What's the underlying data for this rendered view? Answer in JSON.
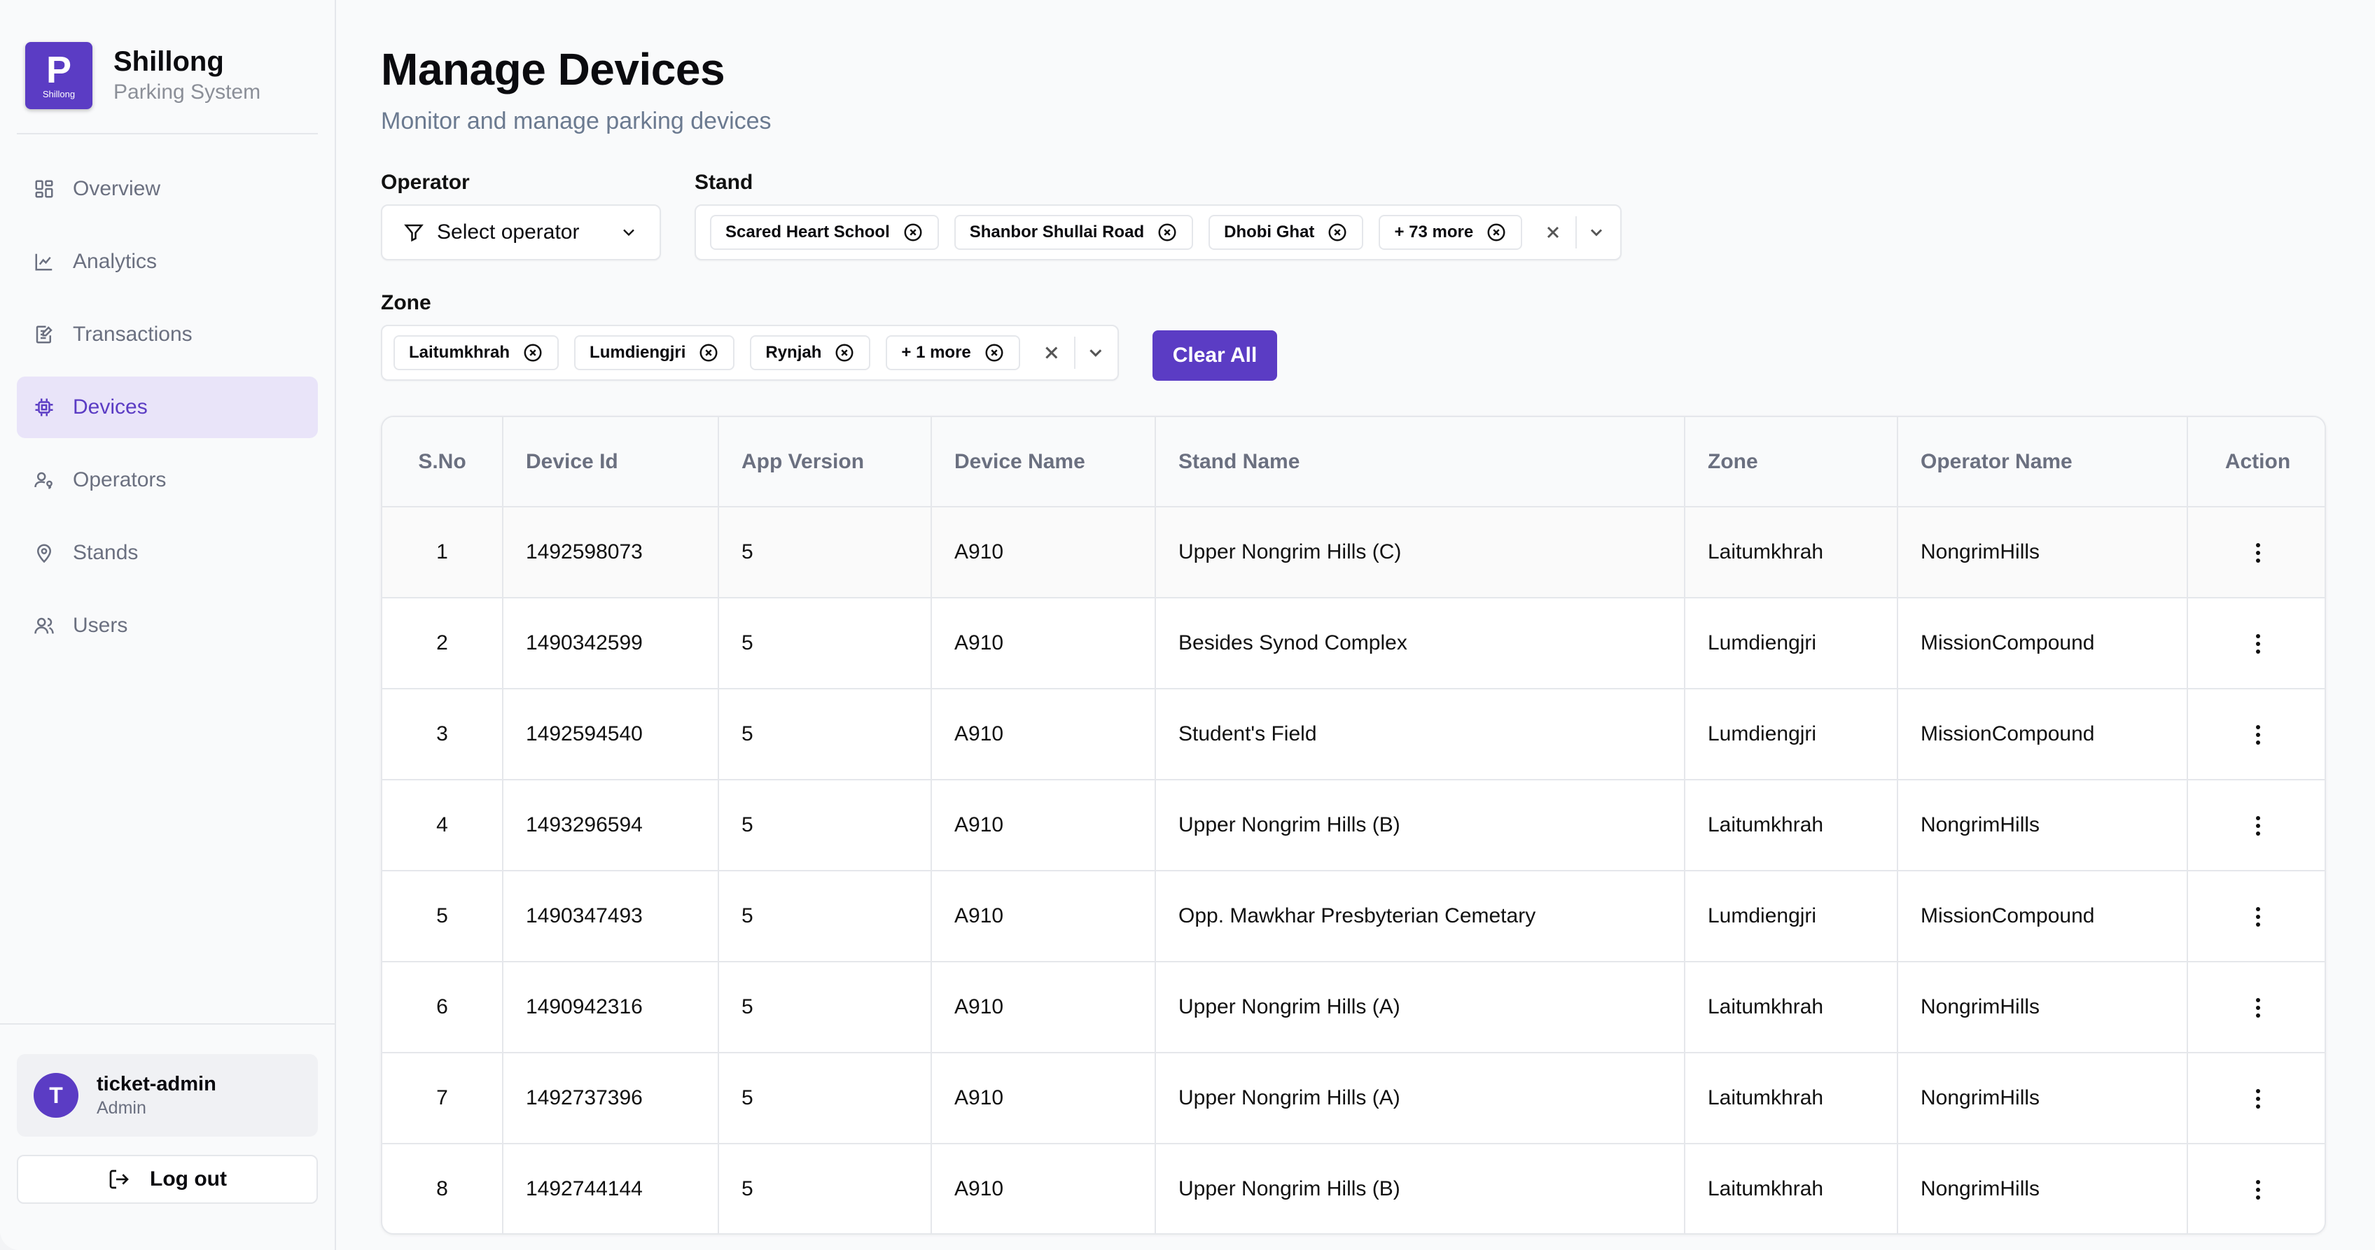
{
  "brand": {
    "logo_letter": "P",
    "logo_small": "Shillong",
    "title": "Shillong",
    "subtitle": "Parking System"
  },
  "nav": {
    "items": [
      {
        "label": "Overview",
        "icon": "grid-icon"
      },
      {
        "label": "Analytics",
        "icon": "chart-line-icon"
      },
      {
        "label": "Transactions",
        "icon": "receipt-edit-icon"
      },
      {
        "label": "Devices",
        "icon": "cpu-icon",
        "active": true
      },
      {
        "label": "Operators",
        "icon": "user-key-icon"
      },
      {
        "label": "Stands",
        "icon": "map-pin-icon"
      },
      {
        "label": "Users",
        "icon": "users-icon"
      }
    ]
  },
  "user": {
    "initial": "T",
    "name": "ticket-admin",
    "role": "Admin"
  },
  "logout_label": "Log out",
  "page": {
    "title": "Manage Devices",
    "subtitle": "Monitor and manage parking devices"
  },
  "filters": {
    "operator": {
      "label": "Operator",
      "placeholder": "Select operator"
    },
    "stand": {
      "label": "Stand",
      "chips": [
        "Scared Heart School",
        "Shanbor Shullai Road",
        "Dhobi Ghat",
        "+ 73 more"
      ]
    },
    "zone": {
      "label": "Zone",
      "chips": [
        "Laitumkhrah",
        "Lumdiengjri",
        "Rynjah",
        "+ 1 more"
      ]
    },
    "clear_all": "Clear All"
  },
  "table": {
    "columns": [
      "S.No",
      "Device Id",
      "App Version",
      "Device Name",
      "Stand Name",
      "Zone",
      "Operator Name",
      "Action"
    ],
    "rows": [
      [
        "1",
        "1492598073",
        "5",
        "A910",
        "Upper Nongrim Hills (C)",
        "Laitumkhrah",
        "NongrimHills"
      ],
      [
        "2",
        "1490342599",
        "5",
        "A910",
        "Besides Synod Complex",
        "Lumdiengjri",
        "MissionCompound"
      ],
      [
        "3",
        "1492594540",
        "5",
        "A910",
        "Student's Field",
        "Lumdiengjri",
        "MissionCompound"
      ],
      [
        "4",
        "1493296594",
        "5",
        "A910",
        "Upper Nongrim Hills (B)",
        "Laitumkhrah",
        "NongrimHills"
      ],
      [
        "5",
        "1490347493",
        "5",
        "A910",
        "Opp. Mawkhar Presbyterian Cemetary",
        "Lumdiengjri",
        "MissionCompound"
      ],
      [
        "6",
        "1490942316",
        "5",
        "A910",
        "Upper Nongrim Hills (A)",
        "Laitumkhrah",
        "NongrimHills"
      ],
      [
        "7",
        "1492737396",
        "5",
        "A910",
        "Upper Nongrim Hills (A)",
        "Laitumkhrah",
        "NongrimHills"
      ],
      [
        "8",
        "1492744144",
        "5",
        "A910",
        "Upper Nongrim Hills (B)",
        "Laitumkhrah",
        "NongrimHills"
      ]
    ]
  },
  "colors": {
    "accent": "#5b3cc4",
    "active_bg": "#e9e4f9",
    "muted_text": "#6b7080"
  }
}
